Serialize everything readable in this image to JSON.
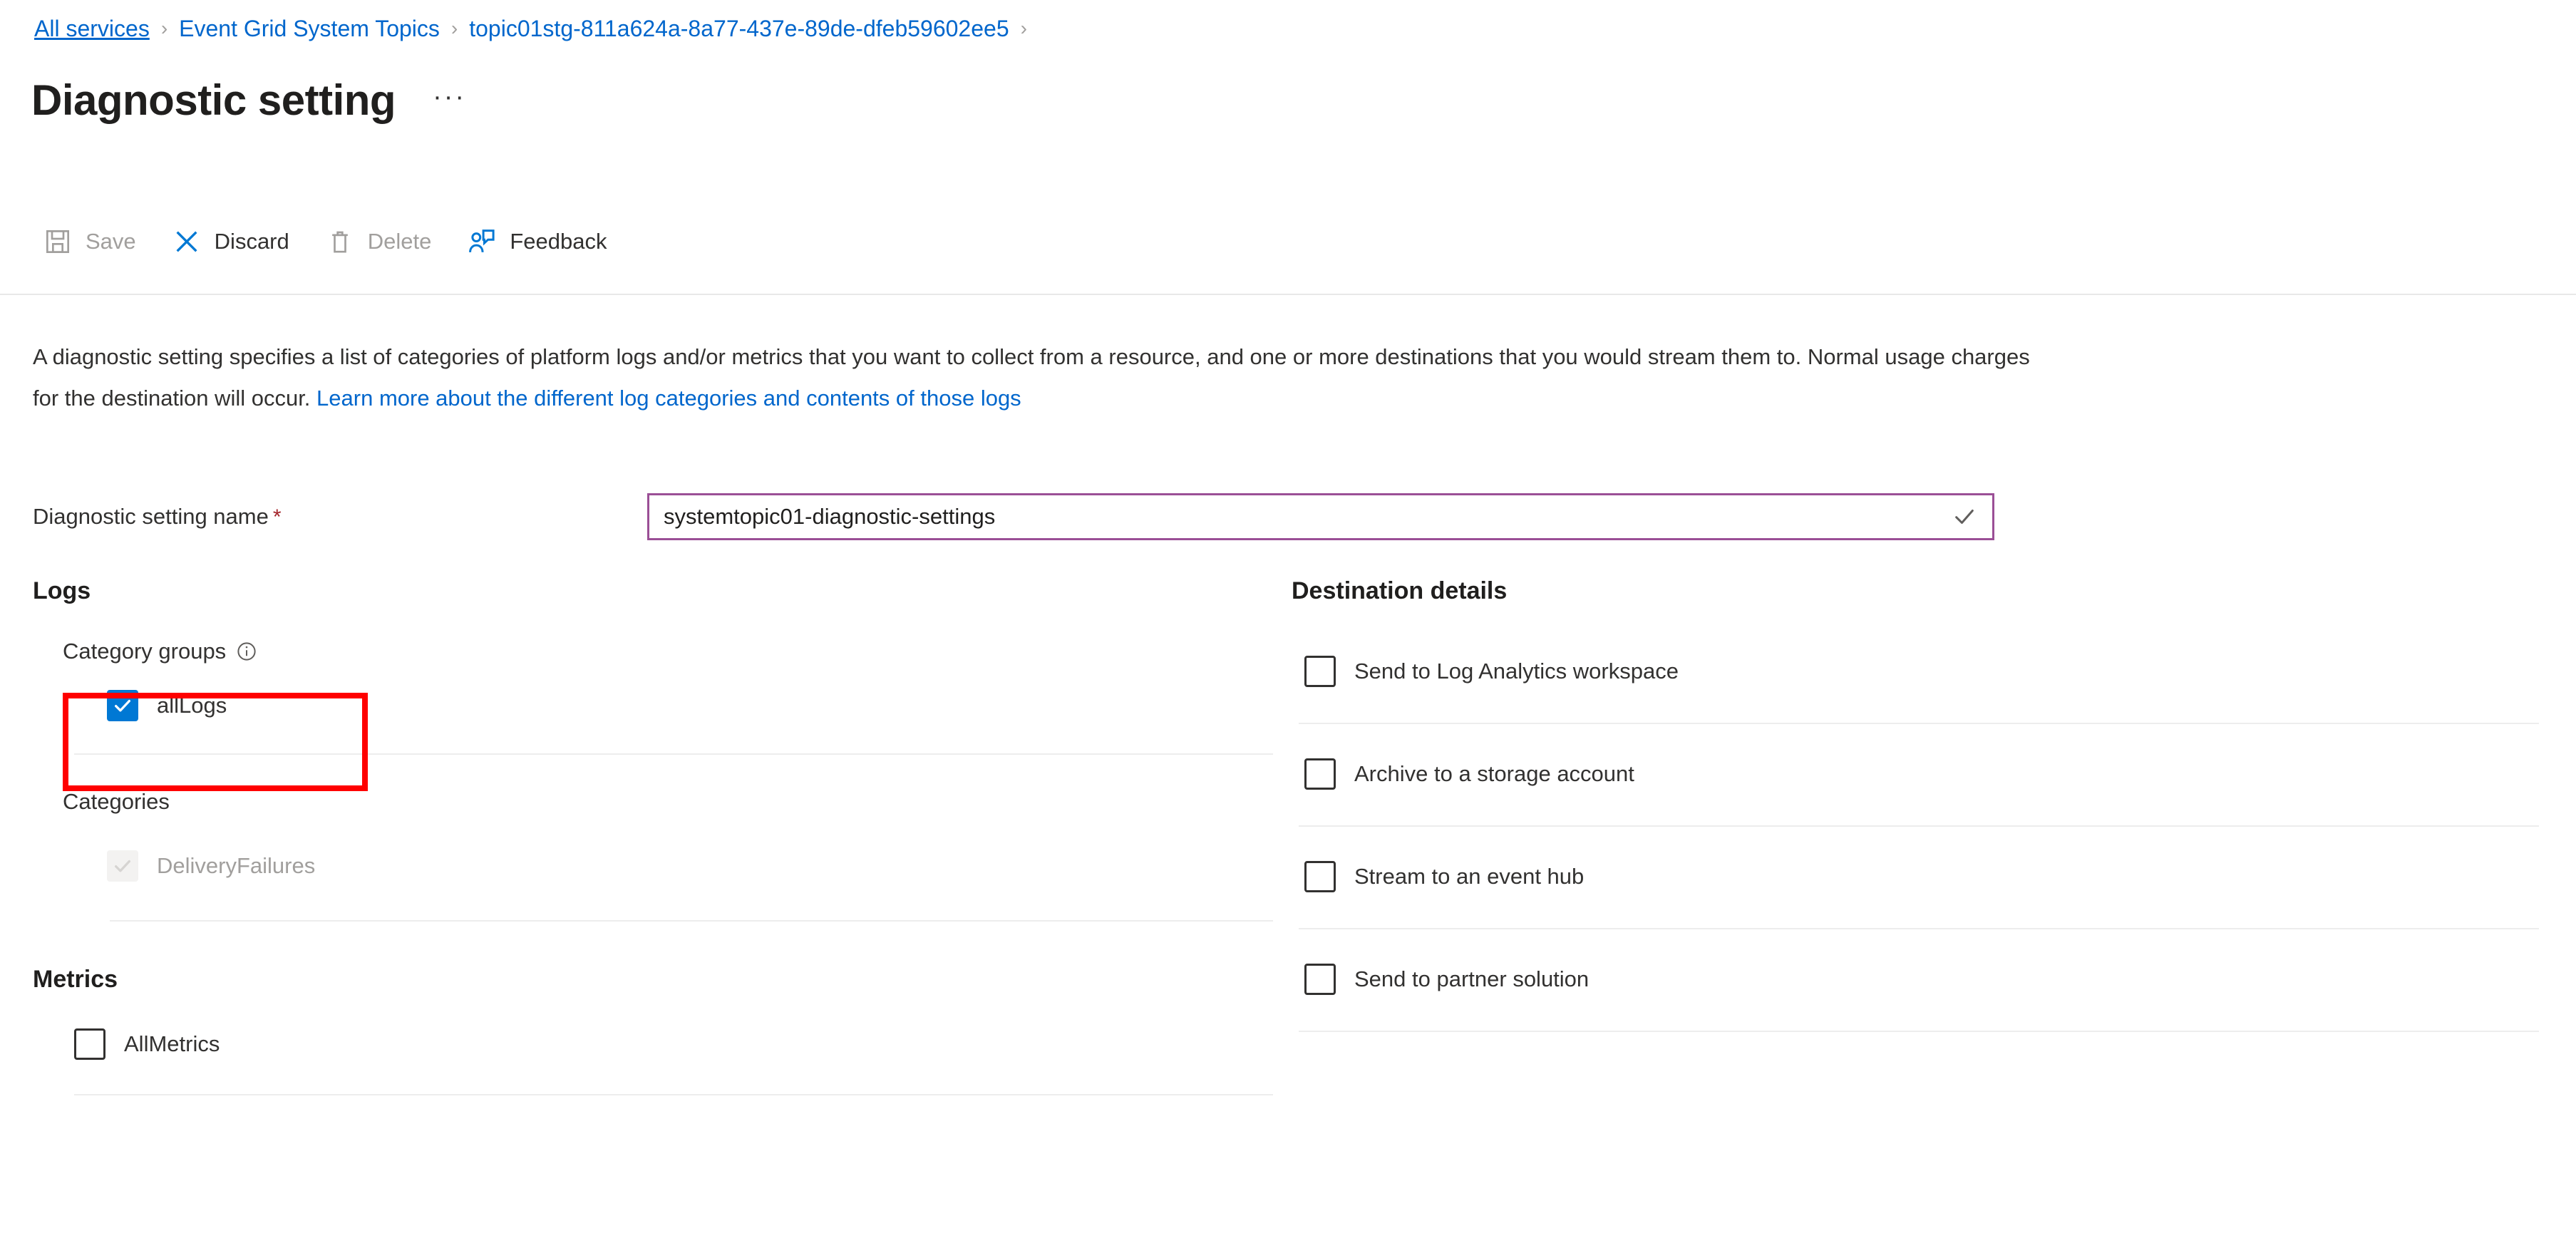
{
  "breadcrumb": {
    "items": [
      {
        "label": "All services",
        "type": "link"
      },
      {
        "label": "Event Grid System Topics",
        "type": "link"
      },
      {
        "label": "topic01stg-811a624a-8a77-437e-89de-dfeb59602ee5",
        "type": "link"
      }
    ],
    "separator": "›"
  },
  "header": {
    "title": "Diagnostic setting",
    "overflow_label": "···"
  },
  "toolbar": {
    "buttons": [
      {
        "label": "Save",
        "icon": "save-icon",
        "enabled": false
      },
      {
        "label": "Discard",
        "icon": "discard-icon",
        "enabled": true
      },
      {
        "label": "Delete",
        "icon": "delete-icon",
        "enabled": false
      },
      {
        "label": "Feedback",
        "icon": "feedback-icon",
        "enabled": true
      }
    ]
  },
  "description": {
    "text_before": "A diagnostic setting specifies a list of categories of platform logs and/or metrics that you want to collect from a resource, and one or more destinations that you would stream them to. Normal usage charges for the destination will occur. ",
    "link_text": "Learn more about the different log categories and contents of those logs"
  },
  "form": {
    "name_label": "Diagnostic setting name",
    "required_marker": "*",
    "name_value": "systemtopic01-diagnostic-settings",
    "name_placeholder": "",
    "validation_state": "valid"
  },
  "logs": {
    "heading": "Logs",
    "category_groups_label": "Category groups",
    "category_groups_info_icon": "info-icon",
    "category_groups": [
      {
        "label": "allLogs",
        "checked": true,
        "disabled": false,
        "highlighted": true
      }
    ],
    "categories_label": "Categories",
    "categories": [
      {
        "label": "DeliveryFailures",
        "checked": true,
        "disabled": true
      }
    ]
  },
  "metrics": {
    "heading": "Metrics",
    "items": [
      {
        "label": "AllMetrics",
        "checked": false,
        "disabled": false
      }
    ]
  },
  "destination": {
    "heading": "Destination details",
    "options": [
      {
        "label": "Send to Log Analytics workspace",
        "checked": false
      },
      {
        "label": "Archive to a storage account",
        "checked": false
      },
      {
        "label": "Stream to an event hub",
        "checked": false
      },
      {
        "label": "Send to partner solution",
        "checked": false
      }
    ]
  },
  "colors": {
    "accent": "#0078D4",
    "link": "#0066CC",
    "focus_border": "#9B4F96",
    "annotation": "#FF0000",
    "required": "#a4262c",
    "disabled_text": "#a19f9d"
  }
}
